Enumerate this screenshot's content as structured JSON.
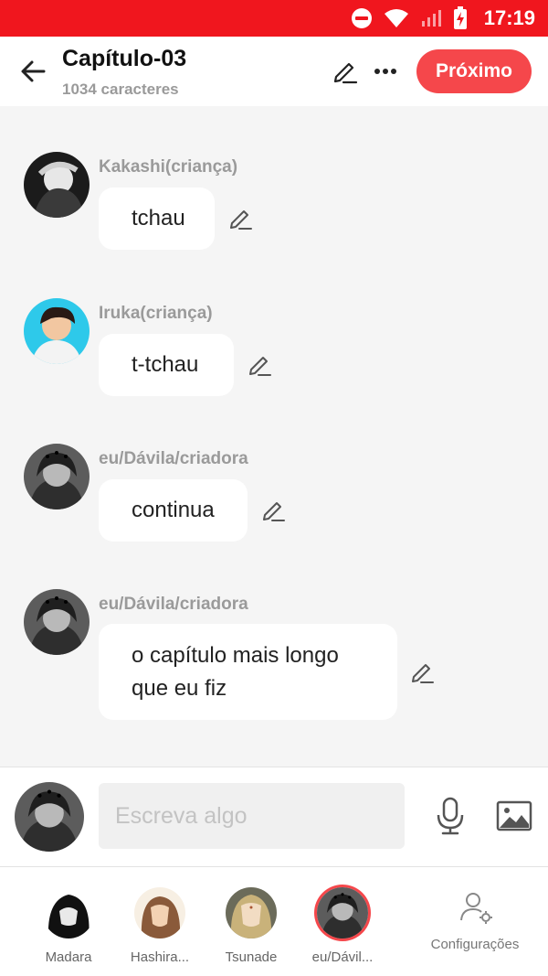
{
  "status_bar": {
    "time": "17:19",
    "icons": [
      "do-not-disturb-icon",
      "wifi-icon",
      "signal-icon",
      "battery-charging-icon"
    ]
  },
  "header": {
    "title": "Capítulo-03",
    "subtitle": "1034 caracteres",
    "next_label": "Próximo",
    "accent_color": "#f5474b"
  },
  "messages": [
    {
      "sender": "Kakashi(criança)",
      "lines": [
        "tchau"
      ]
    },
    {
      "sender": "Iruka(criança)",
      "lines": [
        "t-tchau"
      ]
    },
    {
      "sender": "eu/Dávila/criadora",
      "lines": [
        "continua"
      ]
    },
    {
      "sender": "eu/Dávila/criadora",
      "lines": [
        "o capítulo mais longo",
        "que eu fiz"
      ]
    }
  ],
  "composer": {
    "placeholder": "Escreva algo"
  },
  "characters": [
    {
      "name": "Madara",
      "selected": false
    },
    {
      "name": "Hashira...",
      "selected": false
    },
    {
      "name": "Tsunade",
      "selected": false
    },
    {
      "name": "eu/Dávil...",
      "selected": true
    }
  ],
  "settings_label": "Configurações"
}
